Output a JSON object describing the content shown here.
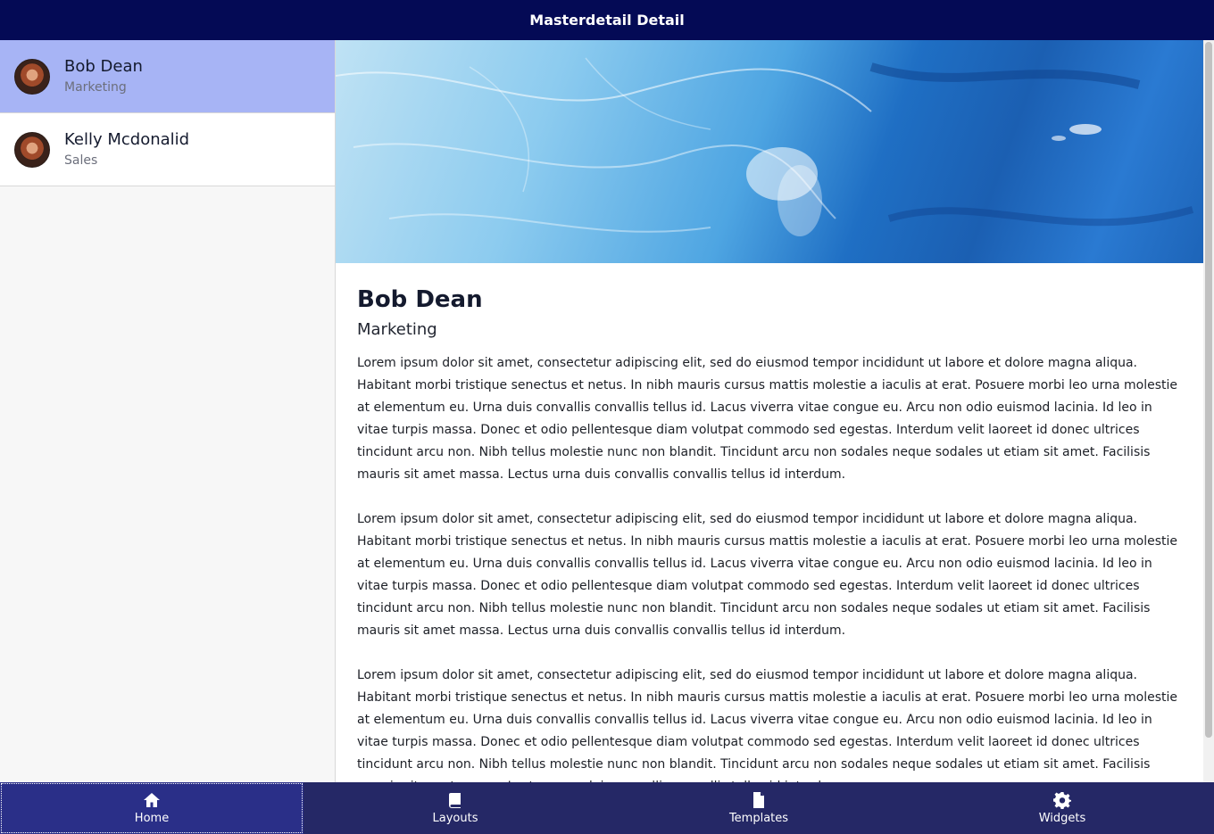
{
  "header": {
    "title": "Masterdetail Detail"
  },
  "master": {
    "items": [
      {
        "name": "Bob Dean",
        "department": "Marketing",
        "selected": true
      },
      {
        "name": "Kelly Mcdonalid",
        "department": "Sales",
        "selected": false
      }
    ]
  },
  "detail": {
    "name": "Bob Dean",
    "department": "Marketing",
    "paragraphs": [
      "Lorem ipsum dolor sit amet, consectetur adipiscing elit, sed do eiusmod tempor incididunt ut labore et dolore magna aliqua. Habitant morbi tristique senectus et netus. In nibh mauris cursus mattis molestie a iaculis at erat. Posuere morbi leo urna molestie at elementum eu. Urna duis convallis convallis tellus id. Lacus viverra vitae congue eu. Arcu non odio euismod lacinia. Id leo in vitae turpis massa. Donec et odio pellentesque diam volutpat commodo sed egestas. Interdum velit laoreet id donec ultrices tincidunt arcu non. Nibh tellus molestie nunc non blandit. Tincidunt arcu non sodales neque sodales ut etiam sit amet. Facilisis mauris sit amet massa. Lectus urna duis convallis convallis tellus id interdum.",
      "Lorem ipsum dolor sit amet, consectetur adipiscing elit, sed do eiusmod tempor incididunt ut labore et dolore magna aliqua. Habitant morbi tristique senectus et netus. In nibh mauris cursus mattis molestie a iaculis at erat. Posuere morbi leo urna molestie at elementum eu. Urna duis convallis convallis tellus id. Lacus viverra vitae congue eu. Arcu non odio euismod lacinia. Id leo in vitae turpis massa. Donec et odio pellentesque diam volutpat commodo sed egestas. Interdum velit laoreet id donec ultrices tincidunt arcu non. Nibh tellus molestie nunc non blandit. Tincidunt arcu non sodales neque sodales ut etiam sit amet. Facilisis mauris sit amet massa. Lectus urna duis convallis convallis tellus id interdum.",
      "Lorem ipsum dolor sit amet, consectetur adipiscing elit, sed do eiusmod tempor incididunt ut labore et dolore magna aliqua. Habitant morbi tristique senectus et netus. In nibh mauris cursus mattis molestie a iaculis at erat. Posuere morbi leo urna molestie at elementum eu. Urna duis convallis convallis tellus id. Lacus viverra vitae congue eu. Arcu non odio euismod lacinia. Id leo in vitae turpis massa. Donec et odio pellentesque diam volutpat commodo sed egestas. Interdum velit laoreet id donec ultrices tincidunt arcu non. Nibh tellus molestie nunc non blandit. Tincidunt arcu non sodales neque sodales ut etiam sit amet. Facilisis mauris sit amet massa. Lectus urna duis convallis convallis tellus id interdum."
    ]
  },
  "bottom_nav": {
    "tabs": [
      {
        "label": "Home",
        "icon": "home-icon",
        "active": true
      },
      {
        "label": "Layouts",
        "icon": "book-icon",
        "active": false
      },
      {
        "label": "Templates",
        "icon": "document-icon",
        "active": false
      },
      {
        "label": "Widgets",
        "icon": "gear-icon",
        "active": false
      }
    ]
  },
  "colors": {
    "topbar": "#040a55",
    "bottombar": "#252866",
    "selected_item": "#a7b4f5"
  }
}
